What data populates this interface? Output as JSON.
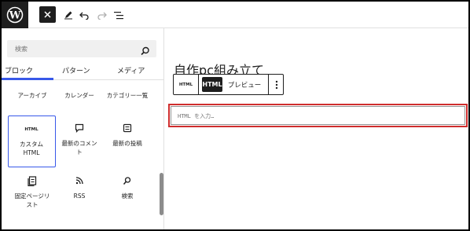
{
  "topbar": {
    "logo_icon": "wordpress-icon",
    "close_icon": "close-icon",
    "tools": [
      "edit-pen-icon",
      "undo-icon",
      "redo-icon",
      "list-view-icon"
    ]
  },
  "inserter": {
    "search": {
      "placeholder": "検索",
      "icon": "search-icon"
    },
    "tabs": [
      {
        "label": "ブロック",
        "active": true
      },
      {
        "label": "パターン",
        "active": false
      },
      {
        "label": "メディア",
        "active": false
      }
    ],
    "blocks": [
      {
        "label": "アーカイブ",
        "icon": "archive-icon"
      },
      {
        "label": "カレンダー",
        "icon": "calendar-icon"
      },
      {
        "label": "カテゴリー一覧",
        "icon": "category-icon"
      },
      {
        "label": "カスタム HTML",
        "icon": "html-icon",
        "icon_text": "HTML",
        "selected": true
      },
      {
        "label": "最新のコメント",
        "icon": "comment-icon"
      },
      {
        "label": "最新の投稿",
        "icon": "posts-icon"
      },
      {
        "label": "固定ページリスト",
        "icon": "pages-icon"
      },
      {
        "label": "RSS",
        "icon": "rss-icon"
      },
      {
        "label": "検索",
        "icon": "search-icon"
      }
    ]
  },
  "editor": {
    "post_title": "自作pc組み立て　　",
    "block_toolbar": {
      "block_icon_text": "HTML",
      "html_tab": "HTML",
      "preview_tab": "プレビュー",
      "more_icon": "more-vertical-icon"
    },
    "html_block": {
      "placeholder": "HTML を入力…"
    }
  },
  "colors": {
    "accent": "#3858e9",
    "highlight": "#cf2e2e",
    "dark": "#1e1e1e"
  }
}
